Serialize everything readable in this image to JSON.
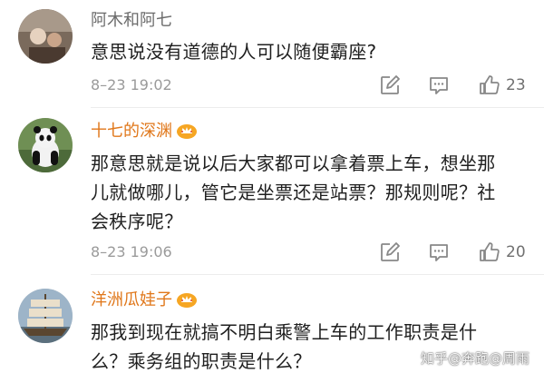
{
  "comments": [
    {
      "username": "阿木和阿七",
      "vip": false,
      "text_lines": [
        "意思说没有道德的人可以随便霸座?"
      ],
      "time": "8–23 19:02",
      "likes": "23"
    },
    {
      "username": "十七的深渊",
      "vip": true,
      "text_lines": [
        "那意思就是说以后大家都可以拿着票上车，想坐那",
        "儿就做哪儿，管它是坐票还是站票？那规则呢？社",
        "会秩序呢？"
      ],
      "time": "8–23 19:06",
      "likes": "20"
    },
    {
      "username": "洋洲瓜娃子",
      "vip": true,
      "text_lines": [
        "那我到现在就搞不明白乘警上车的工作职责是什",
        "么？乘务组的职责是什么？"
      ]
    }
  ],
  "watermark": "知乎@奔跑@周雨",
  "colors": {
    "vip_name": "#e0771a",
    "plain_name": "#6b6b6b",
    "meta": "#9a9a9a"
  },
  "icons": {
    "reply": "edit-square-icon",
    "comment": "speech-bubble-icon",
    "like": "thumbs-up-icon",
    "vip": "crown-icon"
  }
}
